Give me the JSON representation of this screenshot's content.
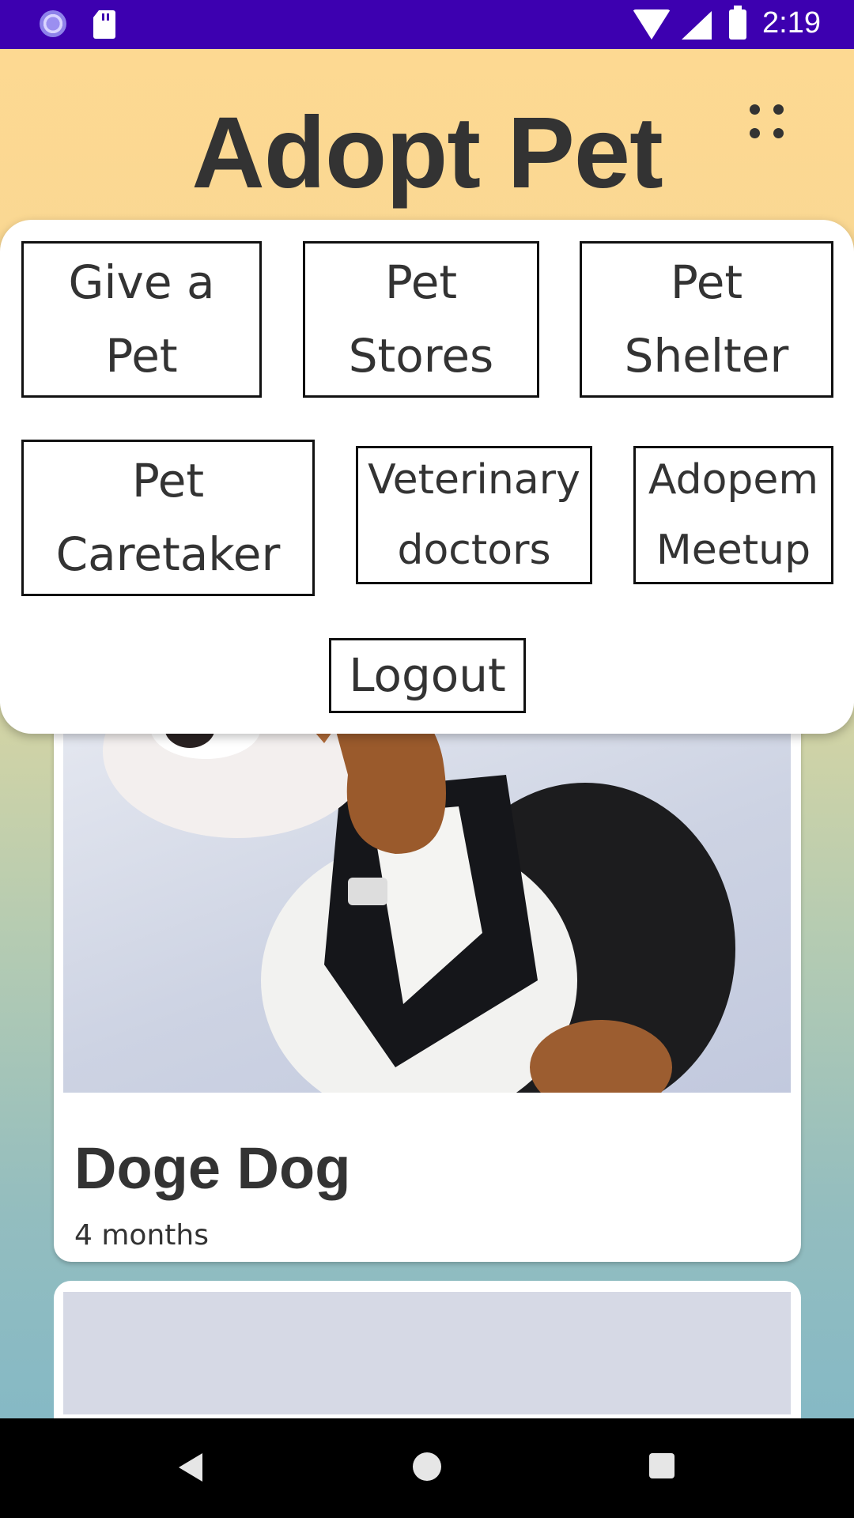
{
  "status_bar": {
    "time": "2:19",
    "icons": [
      "spinner-icon",
      "sd-card-icon",
      "wifi-icon",
      "signal-icon",
      "battery-icon"
    ]
  },
  "header": {
    "title": "Adopt Pet",
    "menu_icon": "dots-grid-icon"
  },
  "menu": {
    "items": [
      {
        "line1": "Give a",
        "line2": "Pet"
      },
      {
        "line1": "Pet",
        "line2": "Stores"
      },
      {
        "line1": "Pet",
        "line2": "Shelter"
      },
      {
        "line1": "Pet",
        "line2": "Caretaker"
      },
      {
        "line1": "Veterinary",
        "line2": "doctors"
      },
      {
        "line1": "Adopem",
        "line2": "Meetup"
      }
    ],
    "logout_label": "Logout"
  },
  "pet_list": [
    {
      "name": "Doge Dog",
      "age": "4 months"
    }
  ],
  "nav_bar": {
    "icons": [
      "back-icon",
      "home-icon",
      "recents-icon"
    ]
  },
  "colors": {
    "status_bar": "#3d00b0",
    "text": "#333333",
    "gradient_top": "#fed992",
    "gradient_bottom": "#7fb7c8"
  }
}
